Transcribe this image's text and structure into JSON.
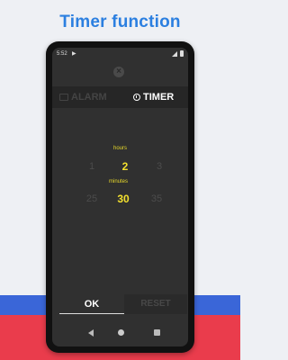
{
  "headline": "Timer function",
  "status_bar": {
    "time": "5:52",
    "play_icon": "▶"
  },
  "close_icon": "×",
  "tabs": [
    {
      "label": "ALARM",
      "icon": "alarm-icon",
      "active": false
    },
    {
      "label": "TIMER",
      "icon": "timer-icon",
      "active": true
    }
  ],
  "picker": {
    "hours_label": "hours",
    "hours": {
      "prev": "1",
      "current": "2",
      "next": "3"
    },
    "minutes_label": "minutes",
    "minutes": {
      "prev": "25",
      "current": "30",
      "next": "35"
    }
  },
  "buttons": {
    "ok": "OK",
    "reset": "RESET"
  },
  "colors": {
    "headline": "#2b7fe0",
    "selected": "#f3e02e",
    "stripe_blue": "#3a66d8",
    "stripe_red": "#ea3c4c"
  }
}
